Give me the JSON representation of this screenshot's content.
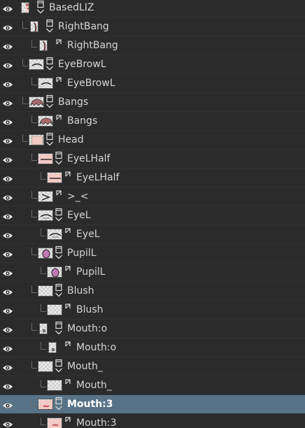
{
  "layers": [
    {
      "name": "BasedLIZ",
      "type": "group",
      "depth": 0,
      "thumb": "avatar",
      "selected": false
    },
    {
      "name": "RightBang",
      "type": "group",
      "depth": 1,
      "thumb": "strip",
      "selected": false
    },
    {
      "name": "RightBang",
      "type": "layer",
      "depth": 2,
      "thumb": "strip",
      "selected": false
    },
    {
      "name": "EyeBrowL",
      "type": "group",
      "depth": 1,
      "thumb": "brow",
      "selected": false
    },
    {
      "name": "EyeBrowL",
      "type": "layer",
      "depth": 2,
      "thumb": "brow",
      "selected": false
    },
    {
      "name": "Bangs",
      "type": "group",
      "depth": 1,
      "thumb": "hair",
      "selected": false
    },
    {
      "name": "Bangs",
      "type": "layer",
      "depth": 2,
      "thumb": "hair",
      "selected": false
    },
    {
      "name": "Head",
      "type": "group",
      "depth": 1,
      "thumb": "face",
      "selected": false
    },
    {
      "name": "EyeLHalf",
      "type": "group",
      "depth": 2,
      "thumb": "eyehalf",
      "selected": false
    },
    {
      "name": "EyeLHalf",
      "type": "layer",
      "depth": 3,
      "thumb": "eyehalf",
      "selected": false
    },
    {
      "name": ">_<",
      "type": "layer",
      "depth": 2,
      "thumb": "squint",
      "selected": false
    },
    {
      "name": "EyeL",
      "type": "group",
      "depth": 2,
      "thumb": "eye",
      "selected": false
    },
    {
      "name": "EyeL",
      "type": "layer",
      "depth": 3,
      "thumb": "eye",
      "selected": false
    },
    {
      "name": "PupilL",
      "type": "group",
      "depth": 2,
      "thumb": "pupil",
      "selected": false
    },
    {
      "name": "PupilL",
      "type": "layer",
      "depth": 3,
      "thumb": "pupil",
      "selected": false
    },
    {
      "name": "Blush",
      "type": "group",
      "depth": 2,
      "thumb": "empty",
      "selected": false
    },
    {
      "name": "Blush",
      "type": "layer",
      "depth": 3,
      "thumb": "empty",
      "selected": false
    },
    {
      "name": "Mouth:o",
      "type": "group",
      "depth": 2,
      "thumb": "mouth-o",
      "selected": false
    },
    {
      "name": "Mouth:o",
      "type": "layer",
      "depth": 3,
      "thumb": "mouth-o",
      "selected": false
    },
    {
      "name": "Mouth_",
      "type": "group",
      "depth": 2,
      "thumb": "empty",
      "selected": false
    },
    {
      "name": "Mouth_",
      "type": "layer",
      "depth": 3,
      "thumb": "empty",
      "selected": false
    },
    {
      "name": "Mouth:3",
      "type": "group",
      "depth": 2,
      "thumb": "mouth3",
      "selected": true
    },
    {
      "name": "Mouth:3",
      "type": "layer",
      "depth": 3,
      "thumb": "mouth3",
      "selected": false
    }
  ],
  "colors": {
    "background": "#2b2b2b",
    "selected_row": "#587387",
    "text": "#d6d6d6",
    "pupil_fill": "#c07ab0",
    "thumb_pink": "#f2c9c4"
  },
  "icons": {
    "visibility": "eye-icon",
    "group": "folder-collapse-icon",
    "layer": "layer-link-icon"
  }
}
